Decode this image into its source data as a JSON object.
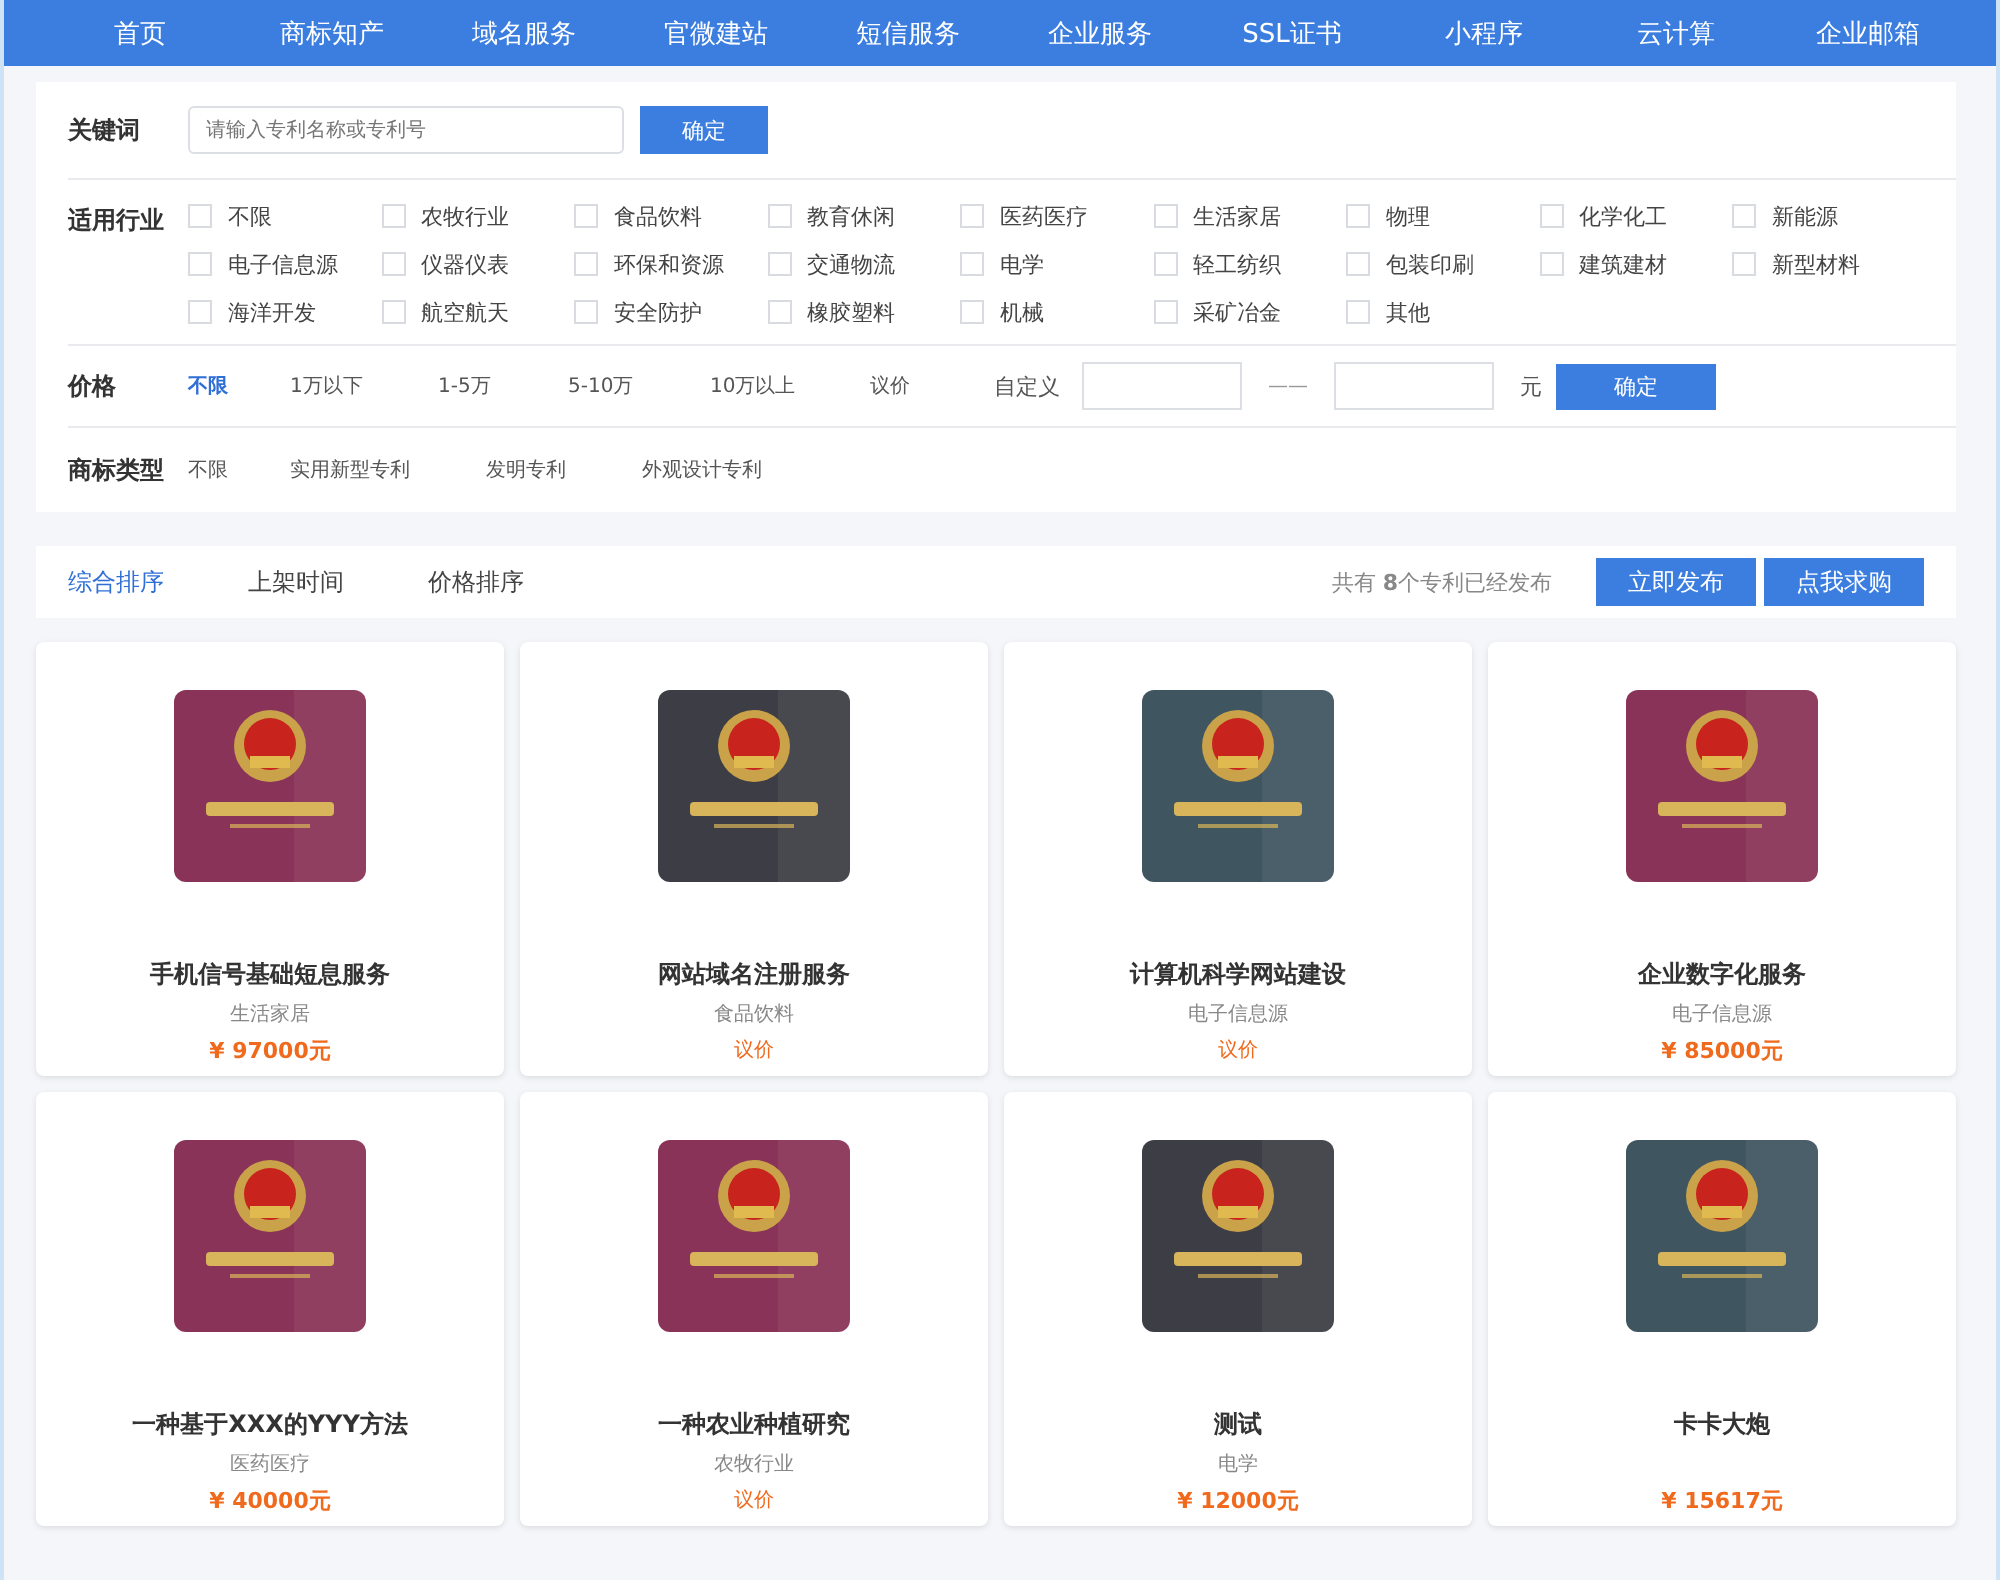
{
  "nav": [
    {
      "label": "首页"
    },
    {
      "label": "商标知产"
    },
    {
      "label": "域名服务"
    },
    {
      "label": "官微建站"
    },
    {
      "label": "短信服务"
    },
    {
      "label": "企业服务"
    },
    {
      "label": "SSL证书"
    },
    {
      "label": "小程序"
    },
    {
      "label": "云计算"
    },
    {
      "label": "企业邮箱"
    }
  ],
  "filters": {
    "keyword": {
      "label": "关键词",
      "placeholder": "请输入专利名称或专利号",
      "button": "确定"
    },
    "industry": {
      "label": "适用行业",
      "options": [
        {
          "label": "不限",
          "checked": false
        },
        {
          "label": "农牧行业",
          "checked": false
        },
        {
          "label": "食品饮料",
          "checked": false
        },
        {
          "label": "教育休闲",
          "checked": false
        },
        {
          "label": "医药医疗",
          "checked": false
        },
        {
          "label": "生活家居",
          "checked": false
        },
        {
          "label": "物理",
          "checked": false
        },
        {
          "label": "化学化工",
          "checked": false
        },
        {
          "label": "新能源",
          "checked": false
        },
        {
          "label": "电子信息源",
          "checked": false
        },
        {
          "label": "仪器仪表",
          "checked": false
        },
        {
          "label": "环保和资源",
          "checked": false
        },
        {
          "label": "交通物流",
          "checked": false
        },
        {
          "label": "电学",
          "checked": false
        },
        {
          "label": "轻工纺织",
          "checked": false
        },
        {
          "label": "包装印刷",
          "checked": false
        },
        {
          "label": "建筑建材",
          "checked": false
        },
        {
          "label": "新型材料",
          "checked": false
        },
        {
          "label": "海洋开发",
          "checked": false
        },
        {
          "label": "航空航天",
          "checked": false
        },
        {
          "label": "安全防护",
          "checked": false
        },
        {
          "label": "橡胶塑料",
          "checked": false
        },
        {
          "label": "机械",
          "checked": false
        },
        {
          "label": "采矿冶金",
          "checked": false
        },
        {
          "label": "其他",
          "checked": false
        }
      ]
    },
    "price": {
      "label": "价格",
      "options": [
        {
          "label": "不限",
          "selected": true
        },
        {
          "label": "1万以下",
          "selected": false
        },
        {
          "label": "1-5万",
          "selected": false
        },
        {
          "label": "5-10万",
          "selected": false
        },
        {
          "label": "10万以上",
          "selected": false
        },
        {
          "label": "议价",
          "selected": false
        }
      ],
      "custom_label": "自定义",
      "separator": "——",
      "unit": "元",
      "button": "确定"
    },
    "type": {
      "label": "商标类型",
      "options": [
        {
          "label": "不限",
          "selected": false
        },
        {
          "label": "实用新型专利",
          "selected": false
        },
        {
          "label": "发明专利",
          "selected": false
        },
        {
          "label": "外观设计专利",
          "selected": false
        }
      ]
    }
  },
  "sort": {
    "tabs": [
      {
        "label": "综合排序",
        "selected": true
      },
      {
        "label": "上架时间",
        "selected": false
      },
      {
        "label": "价格排序",
        "selected": false
      }
    ],
    "count_text": "共有 **8**个专利已经发布",
    "buttons": [
      {
        "label": "立即发布"
      },
      {
        "label": "点我求购"
      }
    ]
  },
  "products": [
    {
      "color": "#8a3358",
      "title": "手机信号基础短息服务",
      "category": "生活家居",
      "kind": "amount",
      "price": "¥ 97000元"
    },
    {
      "color": "#3d3d45",
      "title": "网站域名注册服务",
      "category": "食品饮料",
      "kind": "negotiable",
      "price": "议价"
    },
    {
      "color": "#3f5560",
      "title": "计算机科学网站建设",
      "category": "电子信息源",
      "kind": "negotiable",
      "price": "议价"
    },
    {
      "color": "#8a3358",
      "title": "企业数字化服务",
      "category": "电子信息源",
      "kind": "amount",
      "price": "¥ 85000元"
    },
    {
      "color": "#8a3358",
      "title": "一种基于XXX的YYY方法",
      "category": "医药医疗",
      "kind": "amount",
      "price": "¥ 40000元"
    },
    {
      "color": "#8a3358",
      "title": "一种农业种植研究",
      "category": "农牧行业",
      "kind": "negotiable",
      "price": "议价"
    },
    {
      "color": "#3d3d45",
      "title": "测试",
      "category": "电学",
      "kind": "amount",
      "price": "¥ 12000元"
    },
    {
      "color": "#3f5560",
      "title": "卡卡大炮",
      "kind": "amount",
      "price": "¥ 15617元"
    }
  ]
}
